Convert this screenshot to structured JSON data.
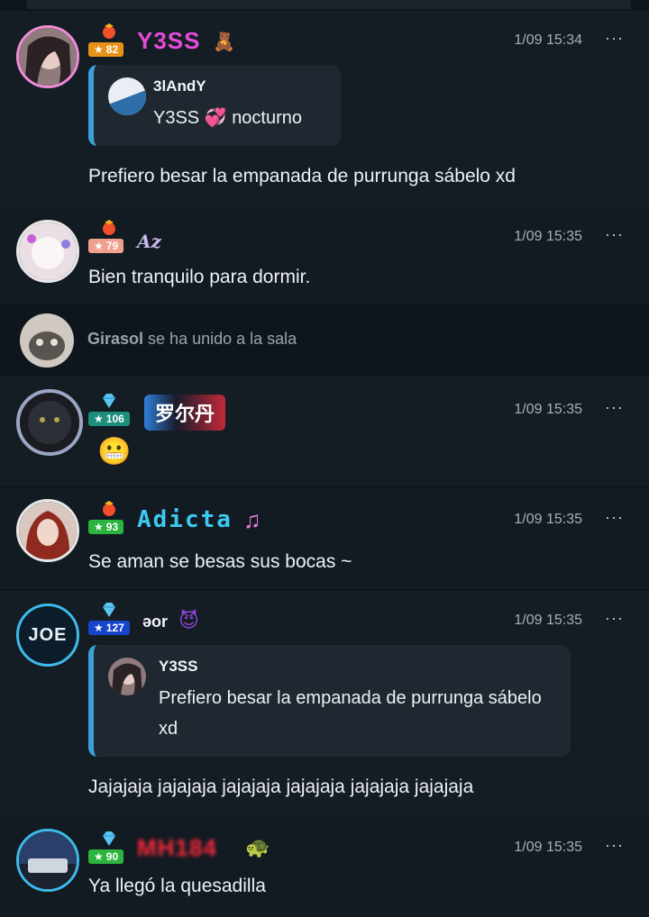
{
  "messages": [
    {
      "user": "Y3SS",
      "level": "82",
      "time": "1/09 15:34",
      "more": "···",
      "quote": {
        "user": "3lAndY",
        "text_before": "Y3SS",
        "text_after": "nocturno"
      },
      "text": "Prefiero besar la empanada de purrunga sábelo xd"
    },
    {
      "user": "Az",
      "level": "79",
      "time": "1/09 15:35",
      "more": "···",
      "text": "Bien tranquilo para dormir."
    },
    {
      "system": {
        "user": "Girasol",
        "action": "se ha unido a la sala"
      }
    },
    {
      "user": "罗尔丹",
      "level": "106",
      "time": "1/09 15:35",
      "more": "···"
    },
    {
      "user": "Adicta",
      "level": "93",
      "time": "1/09 15:35",
      "more": "···",
      "text": "Se aman se besas sus bocas ~"
    },
    {
      "user": "əor",
      "avatar_text": "JOE",
      "level": "127",
      "time": "1/09 15:35",
      "more": "···",
      "quote": {
        "user": "Y3SS",
        "text": "Prefiero besar la empanada de purrunga sábelo xd"
      },
      "text": "Jajajaja jajajaja jajajaja jajajaja jajajaja jajajaja"
    },
    {
      "user": "MH184",
      "level": "90",
      "time": "1/09 15:35",
      "more": "···",
      "text": "Ya llegó la quesadilla"
    }
  ],
  "colors": {
    "background": "#0f151c",
    "quote_accent": "#3aa1d8",
    "name_pink": "#e44bd8",
    "name_cyan": "#3ec9ee",
    "name_red": "#ff2a3a"
  }
}
